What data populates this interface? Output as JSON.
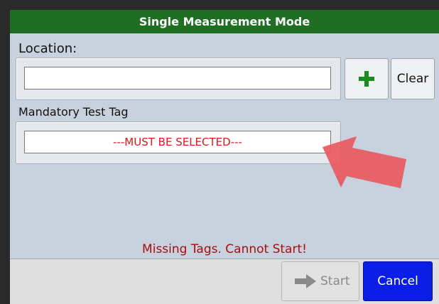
{
  "dialog": {
    "title": "Single Measurement Mode"
  },
  "location": {
    "label": "Location:",
    "value": "",
    "add_icon": "plus-icon",
    "clear_label": "Clear"
  },
  "test_tag": {
    "label": "Mandatory Test Tag",
    "value": "---MUST BE SELECTED---"
  },
  "status": {
    "message": "Missing Tags. Cannot Start!"
  },
  "footer": {
    "start_label": "Start",
    "start_icon": "arrow-right-icon",
    "cancel_label": "Cancel"
  },
  "annotation": {
    "icon": "pointer-arrow-icon"
  },
  "colors": {
    "title_bar": "#1f6e24",
    "error_text": "#e8141b",
    "status_text": "#a50f0f",
    "cancel_button": "#0a1ee8",
    "add_icon": "#1b8a1f",
    "annotation_arrow": "#e8595e"
  }
}
